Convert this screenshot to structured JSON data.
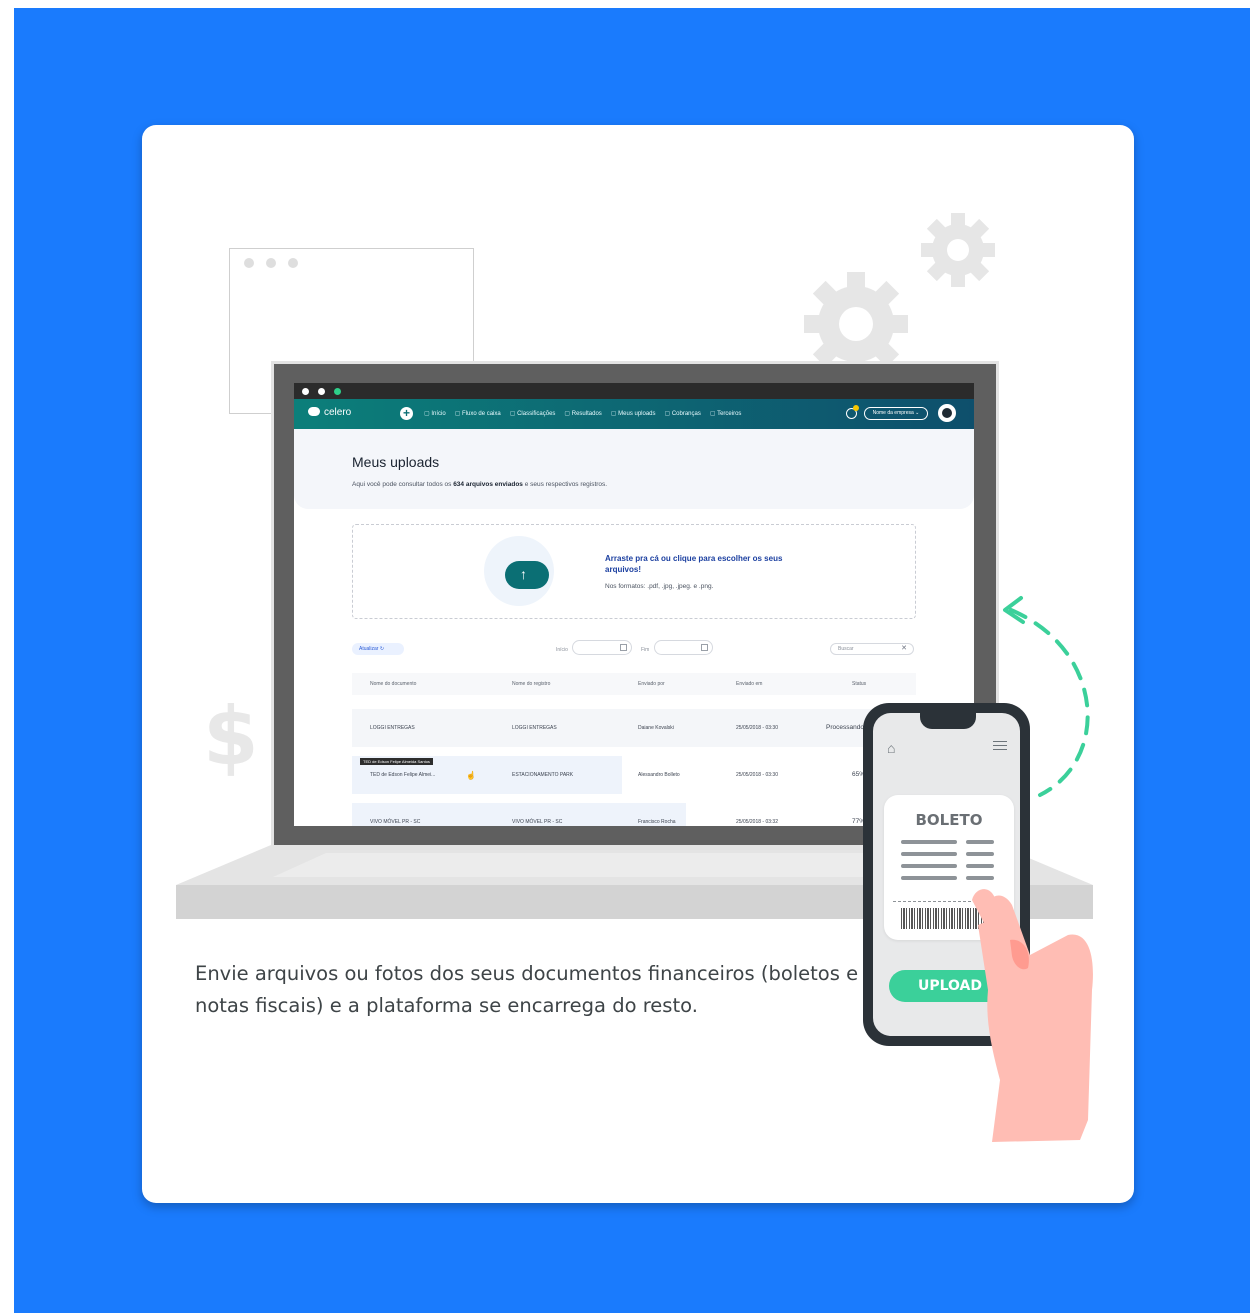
{
  "nav": {
    "brand": "celero",
    "items": [
      "Início",
      "Fluxo de caixa",
      "Classificações",
      "Resultados",
      "Meus uploads",
      "Cobranças",
      "Terceiros"
    ],
    "company_select": "Nome da empresa"
  },
  "uploads_page": {
    "title": "Meus uploads",
    "subtitle_prefix": "Aqui você pode consultar todos os ",
    "subtitle_count": "634 arquivos enviados",
    "subtitle_suffix": " e seus respectivos registros.",
    "dropzone_title": "Arraste pra cá ou clique para escolher os seus arquivos!",
    "dropzone_formats": "Nos formatos: .pdf, .jpg, .jpeg. e .png.",
    "refresh_label": "Atualizar",
    "filter_start_label": "Início",
    "filter_end_label": "Fim",
    "search_placeholder": "Buscar",
    "columns": [
      "Nome do documento",
      "Nome do registro",
      "Enviado por",
      "Enviado em",
      "Status"
    ],
    "rows": [
      {
        "document": "LOGGI ENTREGAS",
        "record": "LOGGI ENTREGAS",
        "sender": "Daiane Kovalski",
        "sent_at": "25/05/2018 - 03:30",
        "status": "Processando"
      },
      {
        "document": "TED de Edson Felipe Almei...",
        "record": "ESTACIONAMENTO PARK",
        "sender": "Alessandro Bolleto",
        "sent_at": "25/05/2018 - 03:30",
        "status": "65%"
      },
      {
        "document": "VIVO MÓVEL PR - SC",
        "record": "VIVO MÓVEL PR - SC",
        "sender": "Francisco Rocha",
        "sent_at": "25/05/2018 - 03:32",
        "status": "77%"
      }
    ],
    "tooltip": "TED de Edson Felipe Almeida Santos"
  },
  "phone": {
    "boleto_label": "BOLETO",
    "upload_button": "UPLOAD"
  },
  "caption": "Envie arquivos ou fotos dos seus documentos financeiros (boletos e notas fiscais) e a plataforma se encarrega do resto.",
  "colors": {
    "background": "#1a7bfd",
    "accent_green": "#3bd09a",
    "nav_teal": "#0c7f7a"
  },
  "icons": [
    "gear-icon",
    "dollar-icon",
    "cloud-upload-icon",
    "home-icon",
    "menu-icon",
    "refresh-icon",
    "calendar-icon",
    "close-icon",
    "bell-icon"
  ]
}
